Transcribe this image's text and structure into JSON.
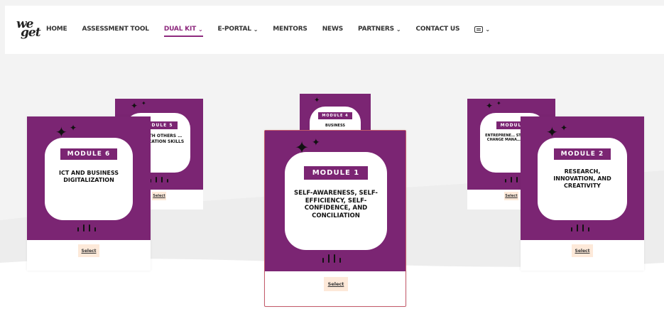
{
  "logo": {
    "line1": "we",
    "line2": "get"
  },
  "nav": {
    "items": [
      {
        "label": "HOME",
        "active": false,
        "dropdown": false
      },
      {
        "label": "ASSESSMENT TOOL",
        "active": false,
        "dropdown": false
      },
      {
        "label": "DUAL KIT",
        "active": true,
        "dropdown": true
      },
      {
        "label": "E-PORTAL",
        "active": false,
        "dropdown": true
      },
      {
        "label": "MENTORS",
        "active": false,
        "dropdown": false
      },
      {
        "label": "NEWS",
        "active": false,
        "dropdown": false
      },
      {
        "label": "PARTNERS",
        "active": false,
        "dropdown": true
      },
      {
        "label": "CONTACT US",
        "active": false,
        "dropdown": false
      }
    ],
    "chat_icon": "chat-icon"
  },
  "colors": {
    "brand": "#7b2573",
    "active_nav": "#8e2a7e",
    "button_bg": "#fde9d9",
    "selected_border": "#c45a6a"
  },
  "modules": {
    "m5": {
      "label": "MODULE 5",
      "title": "…G WITH OTHERS …MMUNICATION SKILLS",
      "button": "Select"
    },
    "m4": {
      "label": "MODULE 4",
      "title": "BUSINESS",
      "button": "Select"
    },
    "m3": {
      "label": "MODULE",
      "title": "ENTREPRENE… STRATEGIES CHANGE MANA… MODELS",
      "button": "Select"
    },
    "m6": {
      "label": "MODULE 6",
      "title": "ICT AND BUSINESS DIGITALIZATION",
      "button": "Select"
    },
    "m1": {
      "label": "MODULE 1",
      "title": "SELF-AWARENESS, SELF-EFFICIENCY, SELF-CONFIDENCE, AND CONCILIATION",
      "button": "Select"
    },
    "m2": {
      "label": "MODULE 2",
      "title": "RESEARCH, INNOVATION, AND CREATIVITY",
      "button": "Select"
    }
  }
}
